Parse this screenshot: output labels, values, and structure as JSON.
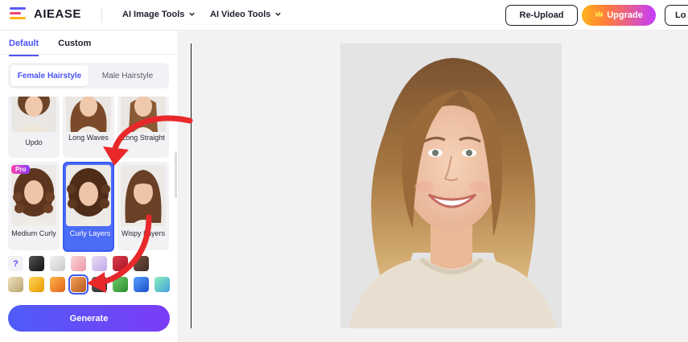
{
  "header": {
    "logo_text": "AIEASE",
    "nav": [
      {
        "label": "AI Image Tools"
      },
      {
        "label": "AI Video Tools"
      }
    ],
    "reupload_label": "Re-Upload",
    "upgrade_label": "Upgrade",
    "login_label": "Lo"
  },
  "panel": {
    "tabs": [
      {
        "label": "Default",
        "active": true
      },
      {
        "label": "Custom",
        "active": false
      }
    ],
    "segments": [
      {
        "label": "Female Hairstyle",
        "active": true
      },
      {
        "label": "Male Hairstyle",
        "active": false
      }
    ],
    "styles_row1": [
      {
        "label": "Updo"
      },
      {
        "label": "Long Waves"
      },
      {
        "label": "Long Straight"
      }
    ],
    "styles_row2": [
      {
        "label": "Medium Curly",
        "badge": "Pro"
      },
      {
        "label": "Curly Layers",
        "selected": true
      },
      {
        "label": "Wispy Layers"
      }
    ],
    "colors_row1": [
      "#ffffff",
      "#1a1a1a",
      "#d8d8d8",
      "#f4b7c0",
      "#d6c3ee",
      "#c41f2d",
      "#5a3a2e"
    ],
    "colors_row2": [
      "#d9c79a",
      "#f3b21e",
      "#f08a1a",
      "#d97a2a",
      "#3a3a3a",
      "#3d8b3d",
      "#2b6cd8",
      "#5fd0a0"
    ],
    "selected_color_index": 3,
    "generate_label": "Generate"
  },
  "icons": {
    "logo": "aiease-logo-icon",
    "chevron": "chevron-down-icon",
    "crown": "crown-icon",
    "question": "question-icon"
  }
}
